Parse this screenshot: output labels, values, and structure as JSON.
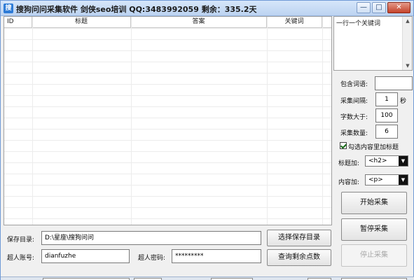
{
  "window": {
    "title": "搜狗问问采集软件 剑侠seo培训 QQ:3483992059 剩余：335.2天",
    "app_icon_glyph": "搜",
    "controls": {
      "minimize": "—",
      "maximize": "□",
      "close": "✕"
    }
  },
  "grid": {
    "columns": [
      "ID",
      "标题",
      "答案",
      "关键词"
    ],
    "rows": []
  },
  "keywords": {
    "text": "一行一个关键词"
  },
  "options": {
    "include_label": "包含词语:",
    "include_value": "",
    "interval_label": "采集间隔:",
    "interval_value": "1",
    "interval_unit": "秒",
    "minchars_label": "字数大于:",
    "minchars_value": "100",
    "count_label": "采集数量:",
    "count_value": "6",
    "checkbox_label": "勾选内容里加标题",
    "checkbox_checked": true,
    "title_add_label": "标题加:",
    "title_add_value": "<h2>",
    "content_add_label": "内容加:",
    "content_add_value": "<p>"
  },
  "buttons": {
    "start": "开始采集",
    "pause": "暂停采集",
    "stop": "停止采集",
    "choose_dir": "选择保存目录",
    "query_points": "查询剩余点数"
  },
  "save": {
    "label": "保存目录:",
    "value": "D:\\星座\\搜狗问问"
  },
  "account": {
    "user_label": "超人账号:",
    "user_value": "dianfuzhe",
    "pass_label": "超人密码:",
    "pass_value": "*********"
  },
  "icons": {
    "dropdown": "▼",
    "scroll_up": "▲",
    "scroll_down": "▼"
  }
}
